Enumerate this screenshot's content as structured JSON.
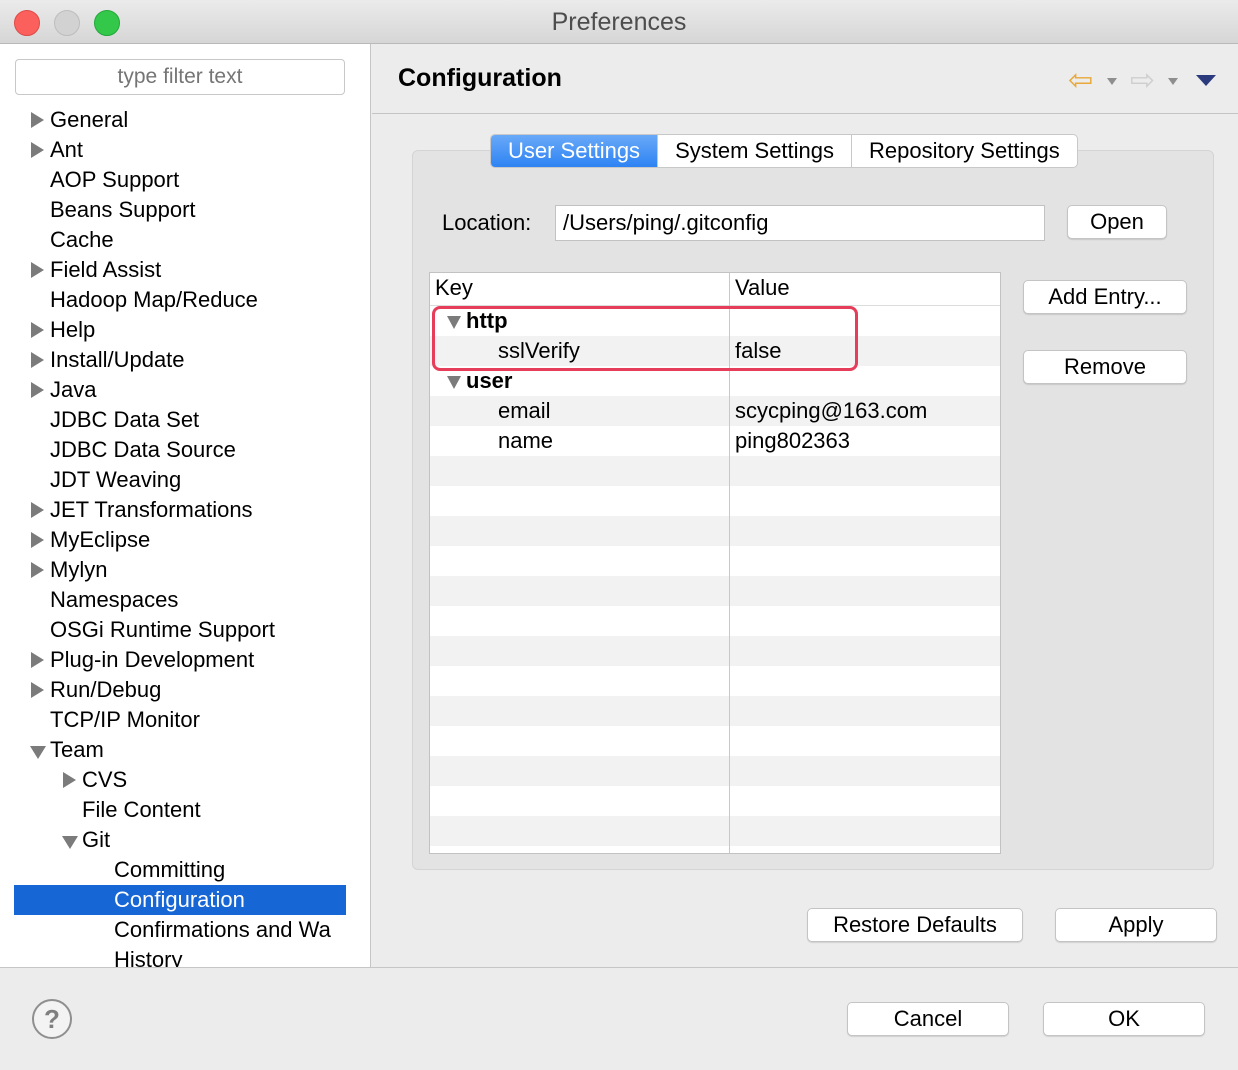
{
  "window": {
    "title": "Preferences"
  },
  "sidebar": {
    "filter_placeholder": "type filter text",
    "items": [
      {
        "label": "General",
        "expander": "collapsed",
        "depth": 0
      },
      {
        "label": "Ant",
        "expander": "collapsed",
        "depth": 0
      },
      {
        "label": "AOP Support",
        "expander": "none",
        "depth": 0
      },
      {
        "label": "Beans Support",
        "expander": "none",
        "depth": 0
      },
      {
        "label": "Cache",
        "expander": "none",
        "depth": 0
      },
      {
        "label": "Field Assist",
        "expander": "collapsed",
        "depth": 0
      },
      {
        "label": "Hadoop Map/Reduce",
        "expander": "none",
        "depth": 0
      },
      {
        "label": "Help",
        "expander": "collapsed",
        "depth": 0
      },
      {
        "label": "Install/Update",
        "expander": "collapsed",
        "depth": 0
      },
      {
        "label": "Java",
        "expander": "collapsed",
        "depth": 0
      },
      {
        "label": "JDBC Data Set",
        "expander": "none",
        "depth": 0
      },
      {
        "label": "JDBC Data Source",
        "expander": "none",
        "depth": 0
      },
      {
        "label": "JDT Weaving",
        "expander": "none",
        "depth": 0
      },
      {
        "label": "JET Transformations",
        "expander": "collapsed",
        "depth": 0
      },
      {
        "label": "MyEclipse",
        "expander": "collapsed",
        "depth": 0
      },
      {
        "label": "Mylyn",
        "expander": "collapsed",
        "depth": 0
      },
      {
        "label": "Namespaces",
        "expander": "none",
        "depth": 0
      },
      {
        "label": "OSGi Runtime Support",
        "expander": "none",
        "depth": 0
      },
      {
        "label": "Plug-in Development",
        "expander": "collapsed",
        "depth": 0
      },
      {
        "label": "Run/Debug",
        "expander": "collapsed",
        "depth": 0
      },
      {
        "label": "TCP/IP Monitor",
        "expander": "none",
        "depth": 0
      },
      {
        "label": "Team",
        "expander": "expanded",
        "depth": 0
      },
      {
        "label": "CVS",
        "expander": "collapsed",
        "depth": 1
      },
      {
        "label": "File Content",
        "expander": "none",
        "depth": 1
      },
      {
        "label": "Git",
        "expander": "expanded",
        "depth": 1
      },
      {
        "label": "Committing",
        "expander": "none",
        "depth": 2
      },
      {
        "label": "Configuration",
        "expander": "none",
        "depth": 2,
        "selected": true
      },
      {
        "label": "Confirmations and Wa",
        "expander": "none",
        "depth": 2
      },
      {
        "label": "History",
        "expander": "none",
        "depth": 2
      }
    ],
    "selection_color": "#1766d5"
  },
  "page": {
    "title": "Configuration",
    "nav": {
      "back_icon": "back-arrow-icon",
      "forward_icon": "forward-arrow-icon",
      "menu_icon": "view-menu-icon"
    },
    "tabs": [
      {
        "label": "User Settings",
        "active": true
      },
      {
        "label": "System Settings",
        "active": false
      },
      {
        "label": "Repository Settings",
        "active": false
      }
    ],
    "location_label": "Location:",
    "location_value": "/Users/ping/.gitconfig",
    "open_button": "Open",
    "add_entry_button": "Add Entry...",
    "remove_button": "Remove",
    "table": {
      "columns": [
        "Key",
        "Value"
      ],
      "rows": [
        {
          "key": "http",
          "value": "",
          "section": true
        },
        {
          "key": "sslVerify",
          "value": "false",
          "section": false
        },
        {
          "key": "user",
          "value": "",
          "section": true
        },
        {
          "key": "email",
          "value": "scycping@163.com",
          "section": false
        },
        {
          "key": "name",
          "value": "ping802363",
          "section": false
        }
      ],
      "highlight_color": "#e53d5a"
    },
    "restore_defaults_button": "Restore Defaults",
    "apply_button": "Apply"
  },
  "footer": {
    "help_icon": "help-icon",
    "help_glyph": "?",
    "cancel_button": "Cancel",
    "ok_button": "OK"
  },
  "colors": {
    "tab_active": "#2d83f3",
    "close": "#fc605c",
    "maximize": "#34c84a"
  }
}
